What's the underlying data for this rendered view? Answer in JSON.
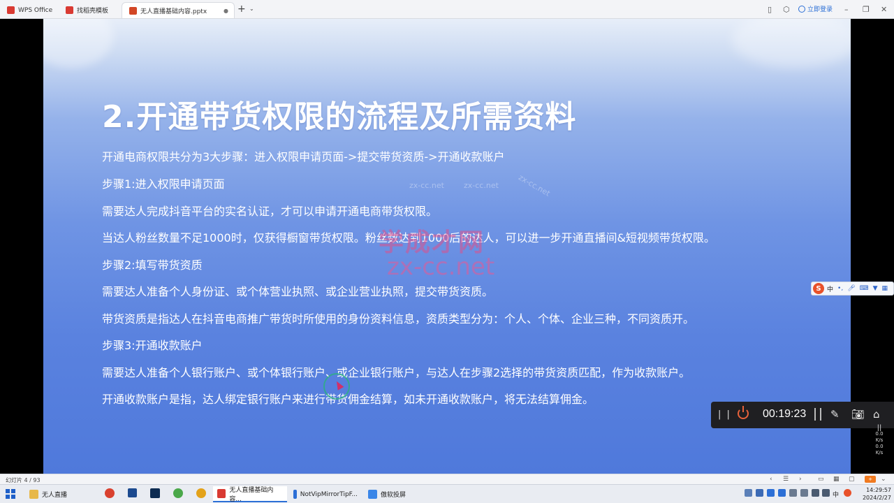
{
  "window": {
    "tabs": [
      {
        "label": "WPS Office",
        "color": "#d93a32"
      },
      {
        "label": "找稻壳模板",
        "color": "#d93a32"
      },
      {
        "label": "无人直播基础内容.pptx",
        "color": "#d24726"
      }
    ],
    "login_label": "立即登录"
  },
  "slide": {
    "title": "2.开通带货权限的流程及所需资料",
    "lines": [
      "开通电商权限共分为3大步骤：进入权限申请页面->提交带货资质->开通收款账户",
      "步骤1:进入权限申请页面",
      "需要达人完成抖音平台的实名认证，才可以申请开通电商带货权限。",
      "当达人粉丝数量不足1000时，仅获得橱窗带货权限。粉丝数达到1000后的达人，可以进一步开通直播间&短视频带货权限。",
      "步骤2:填写带货资质",
      "需要达人准备个人身份证、或个体营业执照、或企业营业执照，提交带货资质。",
      "带货资质是指达人在抖音电商推广带货时所使用的身份资料信息，资质类型分为：个人、个体、企业三种，不同资质开。",
      "步骤3:开通收款账户",
      "需要达人准备个人银行账户、或个体银行账户、或企业银行账户，与达人在步骤2选择的带货资质匹配，作为收款账户。",
      "开通收款账户是指，达人绑定银行账户来进行带货佣金结算，如未开通收款账户，将无法结算佣金。"
    ],
    "watermark_cn": "学成才网",
    "watermark_en": "zx-cc.net",
    "watermark_small": "zx-cc.net"
  },
  "ime": {
    "mode": "中",
    "logo": "S"
  },
  "recorder": {
    "time": "00:19:23",
    "pause_label": "| |"
  },
  "netmon": {
    "up": "0.0",
    "down": "0.0",
    "unit": "K/s"
  },
  "status": {
    "slide_counter": "幻灯片 4 / 93",
    "zoom_badge": "+"
  },
  "taskbar": {
    "items": [
      {
        "label": "无人直播",
        "color": "#e7b84a"
      },
      {
        "label": "无人直播基础内容...",
        "color": "#d93a32"
      },
      {
        "label": "NotVipMirrorTipF...",
        "color": "#2c6fd6"
      },
      {
        "label": "傲软投屏",
        "color": "#3a86e8"
      }
    ],
    "ime": "中",
    "time": "14:29:57",
    "date": "2024/2/27"
  }
}
